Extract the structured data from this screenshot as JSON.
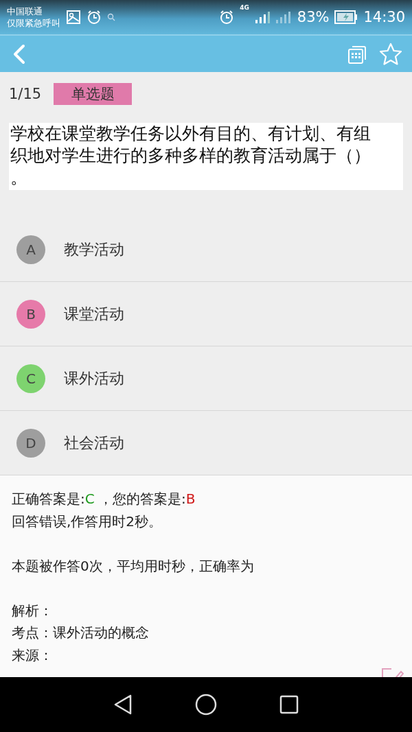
{
  "status_bar": {
    "carrier": "中国联通",
    "emergency": "仅限紧急呼叫",
    "network": "4G",
    "battery": "83%",
    "time": "14:30"
  },
  "question": {
    "counter": "1/15",
    "type": "单选题",
    "text": "学校在课堂教学任务以外有目的、有计划、有组织地对学生进行的多种多样的教育活动属于（）。"
  },
  "options": [
    {
      "letter": "A",
      "text": "教学活动",
      "color": "#9e9e9e"
    },
    {
      "letter": "B",
      "text": "课堂活动",
      "color": "#e67aa9"
    },
    {
      "letter": "C",
      "text": "课外活动",
      "color": "#7ed36f"
    },
    {
      "letter": "D",
      "text": "社会活动",
      "color": "#9e9e9e"
    }
  ],
  "result": {
    "correct_label": "正确答案是:",
    "correct": "C",
    "your_label": " ，您的答案是:",
    "yours": "B",
    "verdict": "回答错误,作答用时2秒。",
    "stats": "本题被作答0次，平均用时秒，正确率为",
    "details": [
      {
        "label": "解析："
      },
      {
        "label": "考点：",
        "value": "课外活动的概念"
      },
      {
        "label": "来源："
      }
    ]
  }
}
